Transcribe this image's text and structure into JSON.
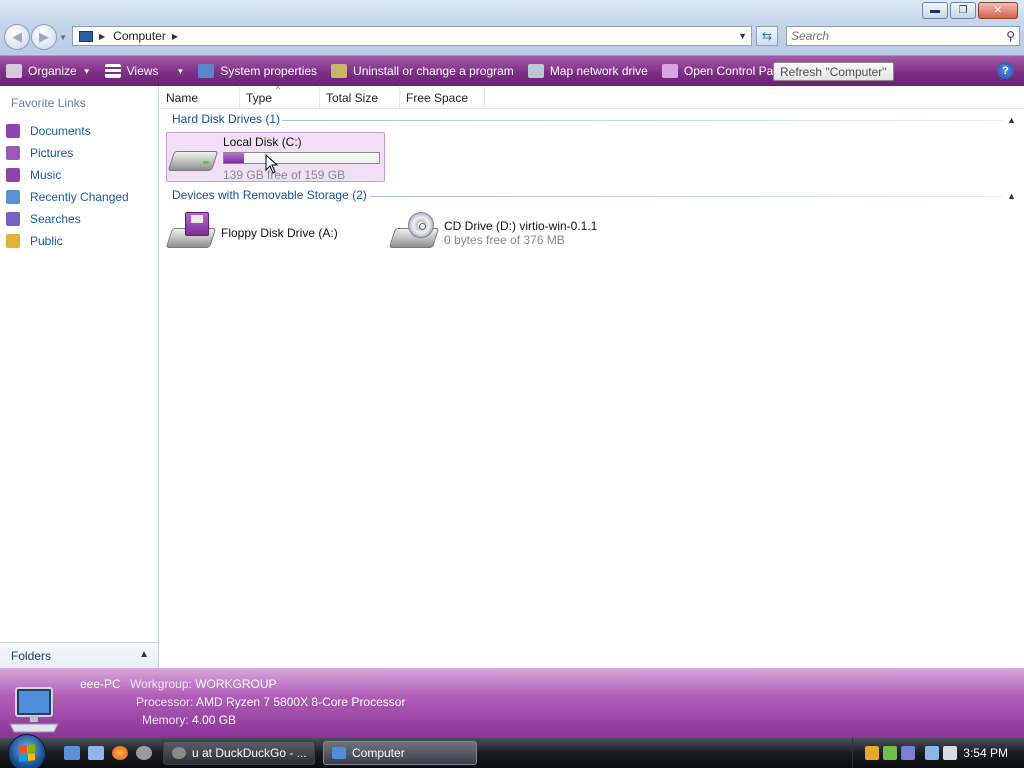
{
  "window": {
    "controls": {
      "minimize": "▬",
      "maximize": "❐",
      "close": "✕"
    }
  },
  "address": {
    "crumb": "Computer"
  },
  "search": {
    "placeholder": "Search"
  },
  "commands": [
    {
      "label": "Organize",
      "icon": "organize-icon",
      "has_dropdown": true
    },
    {
      "label": "Views",
      "icon": "views-icon",
      "has_dropdown": true
    },
    {
      "label": "System properties",
      "icon": "system-properties-icon"
    },
    {
      "label": "Uninstall or change a program",
      "icon": "uninstall-icon"
    },
    {
      "label": "Map network drive",
      "icon": "map-network-drive-icon"
    },
    {
      "label": "Open Control Panel",
      "icon": "control-panel-icon"
    }
  ],
  "tooltip": "Refresh \"Computer\"",
  "help_label": "?",
  "favorites": {
    "title": "Favorite Links",
    "items": [
      {
        "label": "Documents",
        "color": "#8e44ad"
      },
      {
        "label": "Pictures",
        "color": "#9b59b6"
      },
      {
        "label": "Music",
        "color": "#8e44ad"
      },
      {
        "label": "Recently Changed",
        "color": "#5b8fd6"
      },
      {
        "label": "Searches",
        "color": "#7a5fc4"
      },
      {
        "label": "Public",
        "color": "#e0b23a"
      }
    ]
  },
  "folders_label": "Folders",
  "columns": [
    "Name",
    "Type",
    "Total Size",
    "Free Space"
  ],
  "groups": {
    "hard_disk": {
      "title": "Hard Disk Drives (1)",
      "drives": [
        {
          "name": "Local Disk (C:)",
          "free_text": "139 GB free of 159 GB",
          "used_fraction": 0.126
        }
      ]
    },
    "removable": {
      "title": "Devices with Removable Storage (2)",
      "drives": [
        {
          "name": "Floppy Disk Drive (A:)"
        },
        {
          "name": "CD Drive (D:) virtio-win-0.1.1",
          "free_text": "0 bytes free of 376 MB"
        }
      ]
    }
  },
  "details": {
    "computer_name": "eee-PC",
    "workgroup_label": "Workgroup:",
    "workgroup": "WORKGROUP",
    "processor_label": "Processor:",
    "processor": "AMD Ryzen 7 5800X 8-Core Processor",
    "memory_label": "Memory:",
    "memory": "4.00 GB"
  },
  "taskbar": {
    "buttons": [
      {
        "label": "u at DuckDuckGo - ...",
        "active": false
      },
      {
        "label": "Computer",
        "active": true
      }
    ],
    "clock": "3:54 PM"
  },
  "colors": {
    "command_bar": "#7c2f86",
    "link": "#1a5aa9",
    "group_header": "#1e4e9a",
    "selection": "#f1dff6",
    "usage_bar": "#9b45b3"
  }
}
